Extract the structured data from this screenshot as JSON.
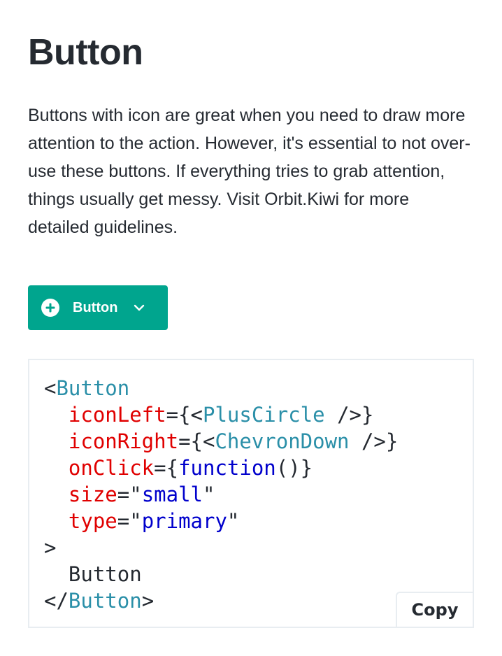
{
  "page": {
    "title": "Button",
    "description": "Buttons with icon are great when you need to draw more attention to the action. However, it's essential to not over-use these buttons. If everything tries to grab attention, things usually get messy. Visit Orbit.Kiwi for more detailed guidelines."
  },
  "demo_button": {
    "label": "Button",
    "icon_left": "plus-circle-icon",
    "icon_right": "chevron-down-icon",
    "background": "#00a58e",
    "text_color": "#ffffff"
  },
  "code": {
    "lines": [
      [
        {
          "t": "<",
          "c": "punct"
        },
        {
          "t": "Button",
          "c": "tag"
        }
      ],
      [
        {
          "t": "  ",
          "c": "punct"
        },
        {
          "t": "iconLeft",
          "c": "attr"
        },
        {
          "t": "={<",
          "c": "punct"
        },
        {
          "t": "PlusCircle",
          "c": "tag"
        },
        {
          "t": " />}",
          "c": "punct"
        }
      ],
      [
        {
          "t": "  ",
          "c": "punct"
        },
        {
          "t": "iconRight",
          "c": "attr"
        },
        {
          "t": "={<",
          "c": "punct"
        },
        {
          "t": "ChevronDown",
          "c": "tag"
        },
        {
          "t": " />}",
          "c": "punct"
        }
      ],
      [
        {
          "t": "  ",
          "c": "punct"
        },
        {
          "t": "onClick",
          "c": "attr"
        },
        {
          "t": "={",
          "c": "punct"
        },
        {
          "t": "function",
          "c": "kw"
        },
        {
          "t": "()}",
          "c": "punct"
        }
      ],
      [
        {
          "t": "  ",
          "c": "punct"
        },
        {
          "t": "size",
          "c": "attr"
        },
        {
          "t": "=\"",
          "c": "punct"
        },
        {
          "t": "small",
          "c": "str"
        },
        {
          "t": "\"",
          "c": "punct"
        }
      ],
      [
        {
          "t": "  ",
          "c": "punct"
        },
        {
          "t": "type",
          "c": "attr"
        },
        {
          "t": "=\"",
          "c": "punct"
        },
        {
          "t": "primary",
          "c": "str"
        },
        {
          "t": "\"",
          "c": "punct"
        }
      ],
      [
        {
          "t": ">",
          "c": "punct"
        }
      ],
      [
        {
          "t": "  Button",
          "c": "punct"
        }
      ],
      [
        {
          "t": "</",
          "c": "punct"
        },
        {
          "t": "Button",
          "c": "tag"
        },
        {
          "t": ">",
          "c": "punct"
        }
      ]
    ],
    "colors": {
      "tag": "#2a8fa8",
      "attr": "#e00000",
      "kw": "#0000cc",
      "punct": "#252a31"
    },
    "copy_label": "Copy"
  }
}
